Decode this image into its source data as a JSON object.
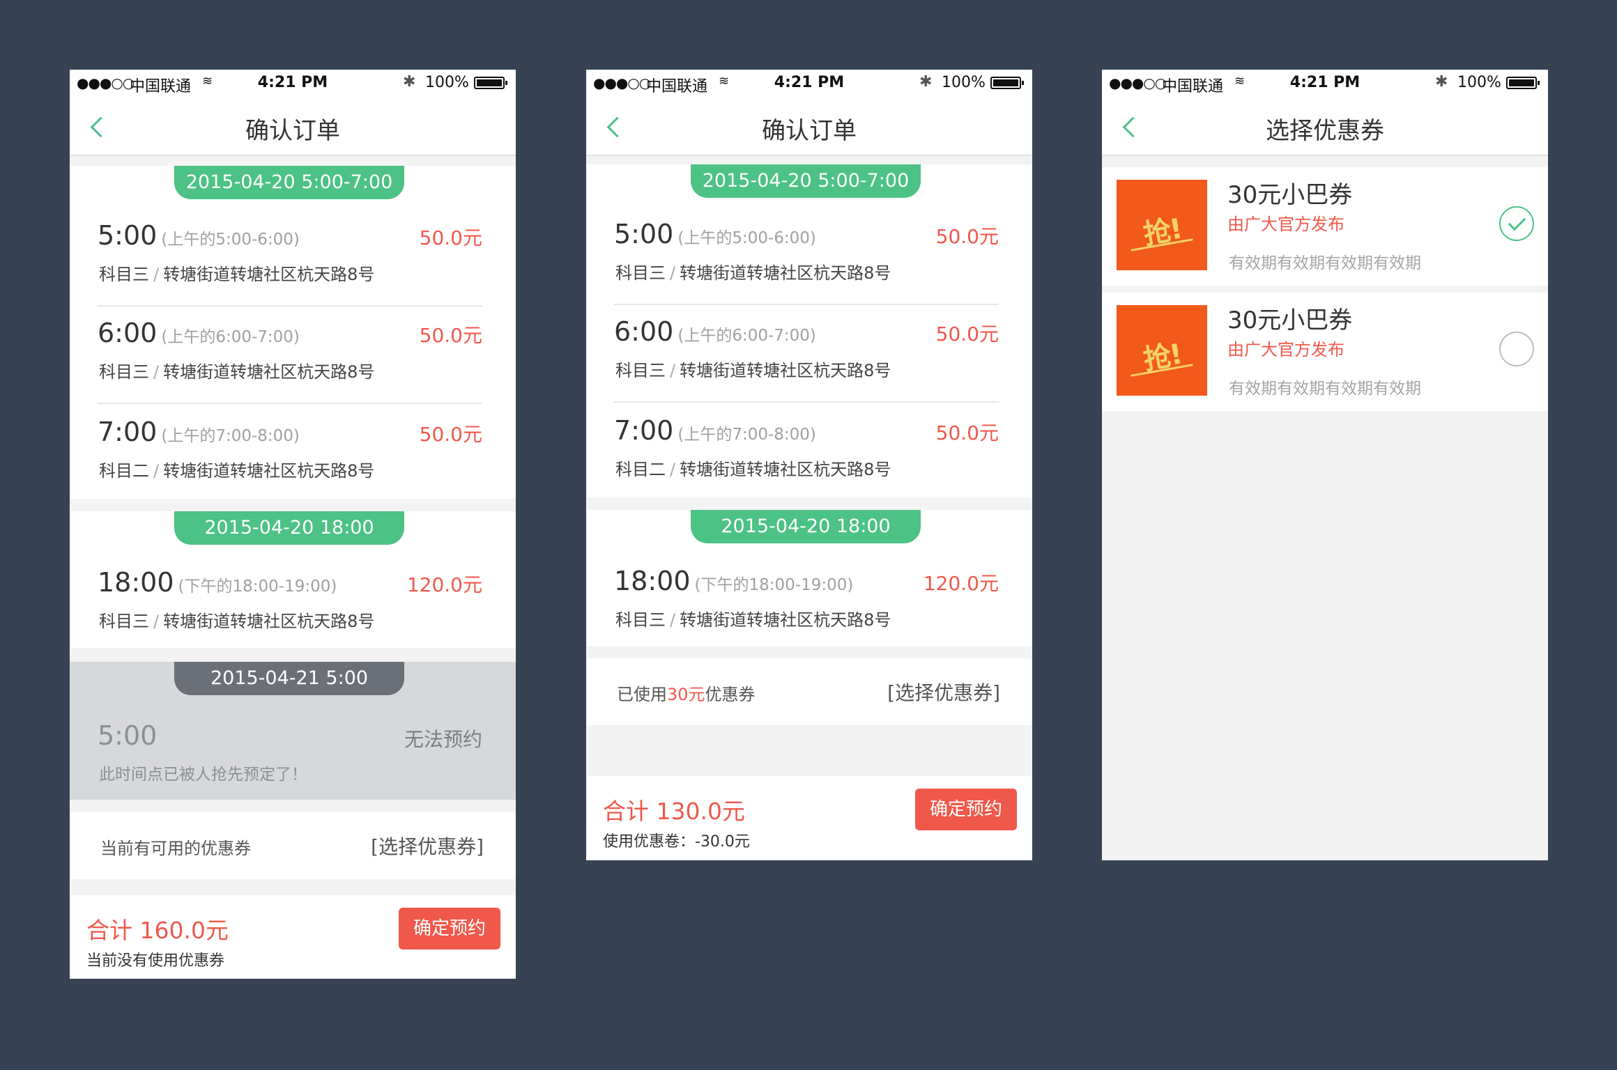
{
  "status_bar": {
    "signal": "●●●○○",
    "carrier": "中国联通",
    "wifi": "≋",
    "time": "4:21 PM",
    "bluetooth": "✱",
    "battery": "100%"
  },
  "screens": {
    "order1": {
      "title": "确认订单",
      "groups": [
        {
          "date": "2015-04-20 5:00-7:00",
          "items": [
            {
              "time": "5:00",
              "range": "(上午的5:00-6:00)",
              "price": "50.0元",
              "subject": "科目三",
              "address": "转塘街道转塘社区杭天路8号"
            },
            {
              "time": "6:00",
              "range": "(上午的6:00-7:00)",
              "price": "50.0元",
              "subject": "科目三",
              "address": "转塘街道转塘社区杭天路8号"
            },
            {
              "time": "7:00",
              "range": "(上午的7:00-8:00)",
              "price": "50.0元",
              "subject": "科目二",
              "address": "转塘街道转塘社区杭天路8号"
            }
          ]
        },
        {
          "date": "2015-04-20 18:00",
          "items": [
            {
              "time": "18:00",
              "range": "(下午的18:00-19:00)",
              "price": "120.0元",
              "subject": "科目三",
              "address": "转塘街道转塘社区杭天路8号"
            }
          ]
        }
      ],
      "blocked": {
        "date": "2015-04-21 5:00",
        "time": "5:00",
        "state": "无法预约",
        "message": "此时间点已被人抢先预定了！"
      },
      "coupon_row": {
        "text": "当前有可用的优惠券",
        "link": "[选择优惠券]"
      },
      "footer": {
        "total": "合计 160.0元",
        "note": "当前没有使用优惠券",
        "confirm": "确定预约"
      }
    },
    "order2": {
      "title": "确认订单",
      "groups": [
        {
          "date": "2015-04-20 5:00-7:00",
          "items": [
            {
              "time": "5:00",
              "range": "(上午的5:00-6:00)",
              "price": "50.0元",
              "subject": "科目三",
              "address": "转塘街道转塘社区杭天路8号"
            },
            {
              "time": "6:00",
              "range": "(上午的6:00-7:00)",
              "price": "50.0元",
              "subject": "科目三",
              "address": "转塘街道转塘社区杭天路8号"
            },
            {
              "time": "7:00",
              "range": "(上午的7:00-8:00)",
              "price": "50.0元",
              "subject": "科目二",
              "address": "转塘街道转塘社区杭天路8号"
            }
          ]
        },
        {
          "date": "2015-04-20 18:00",
          "items": [
            {
              "time": "18:00",
              "range": "(下午的18:00-19:00)",
              "price": "120.0元",
              "subject": "科目三",
              "address": "转塘街道转塘社区杭天路8号"
            }
          ]
        }
      ],
      "coupon_row": {
        "prefix": "已使用",
        "amount": "30元",
        "suffix": "优惠券",
        "link": "[选择优惠券]"
      },
      "footer": {
        "total": "合计 130.0元",
        "note": "使用优惠卷：-30.0元",
        "confirm": "确定预约"
      }
    },
    "coupons": {
      "title": "选择优惠券",
      "list": [
        {
          "logo_text": "抢!",
          "name": "30元小巴券",
          "issuer": "由广大官方发布",
          "validity": "有效期有效期有效期有效期",
          "selected": true
        },
        {
          "logo_text": "抢!",
          "name": "30元小巴券",
          "issuer": "由广大官方发布",
          "validity": "有效期有效期有效期有效期",
          "selected": false
        }
      ]
    }
  },
  "colors": {
    "background": "#374254",
    "accent_green": "#4cc285",
    "accent_red": "#f0584b",
    "blocked_gray": "#d7d8db",
    "coupon_orange": "#f25a1c"
  }
}
